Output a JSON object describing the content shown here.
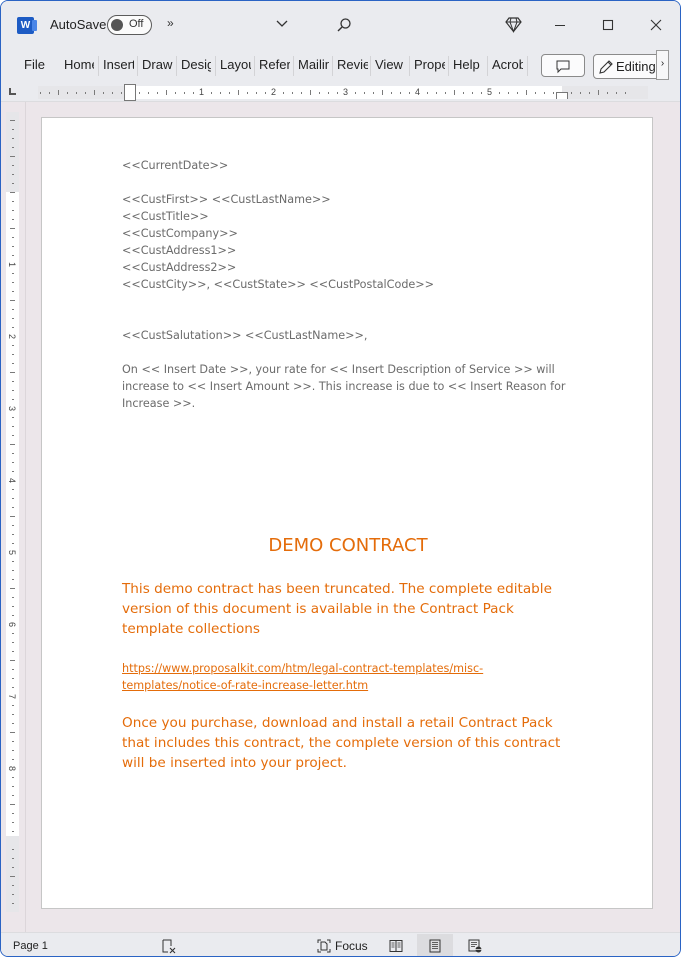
{
  "titlebar": {
    "app_icon": "word-icon",
    "app_letter": "W",
    "autosave_label": "AutoSave",
    "autosave_state": "Off",
    "more_commands": "»",
    "customize_icon": "chevron-down-icon",
    "search_icon": "search-icon",
    "premium_icon": "diamond-icon",
    "minimize_icon": "minimize-icon",
    "maximize_icon": "maximize-icon",
    "close_icon": "close-icon"
  },
  "ribbon": {
    "tabs": [
      {
        "label": "File"
      },
      {
        "label": "Home"
      },
      {
        "label": "Insert"
      },
      {
        "label": "Draw"
      },
      {
        "label": "Design"
      },
      {
        "label": "Layout"
      },
      {
        "label": "References"
      },
      {
        "label": "Mailings"
      },
      {
        "label": "Review"
      },
      {
        "label": "View"
      },
      {
        "label": "Properties"
      },
      {
        "label": "Help"
      },
      {
        "label": "Acrobat"
      }
    ],
    "comment_icon": "comment-icon",
    "editing_label": "Editing",
    "editing_icon": "pencil-icon",
    "scroll_right": "›"
  },
  "ruler": {
    "horizontal_numbers": [
      "1",
      "2",
      "3",
      "4",
      "5"
    ],
    "vertical_numbers": [
      "1",
      "2",
      "3",
      "4",
      "5",
      "6",
      "7",
      "8"
    ]
  },
  "document": {
    "current_date": "<<CurrentDate>>",
    "address_lines": [
      "<<CustFirst>> <<CustLastName>>",
      "<<CustTitle>>",
      "<<CustCompany>>",
      "<<CustAddress1>>",
      "<<CustAddress2>>",
      "<<CustCity>>, <<CustState>>  <<CustPostalCode>>"
    ],
    "salutation": "<<CustSalutation>> <<CustLastName>>,",
    "body": "On << Insert Date >>, your rate for << Insert Description of Service >> will increase to << Insert Amount >>. This increase is due to << Insert Reason for Increase >>.",
    "demo_title": "DEMO CONTRACT",
    "demo_paragraph_1": "This demo contract has been truncated. The complete editable version of this document is available in the Contract Pack template collections",
    "demo_link": "https://www.proposalkit.com/htm/legal-contract-templates/misc-templates/notice-of-rate-increase-letter.htm",
    "demo_paragraph_2": "Once you purchase, download and install a retail Contract Pack that includes this contract, the complete version of this contract will be inserted into your project."
  },
  "statusbar": {
    "page_label": "Page 1",
    "proofing_icon": "proofing-icon",
    "focus_label": "Focus",
    "read_mode_icon": "read-mode-icon",
    "print_layout_icon": "print-layout-icon",
    "web_layout_icon": "web-layout-icon"
  },
  "colors": {
    "accent_orange": "#e46c0a",
    "placeholder_gray": "#6b6b6b",
    "window_border": "#2a63c4",
    "word_blue": "#1d5bc4"
  }
}
